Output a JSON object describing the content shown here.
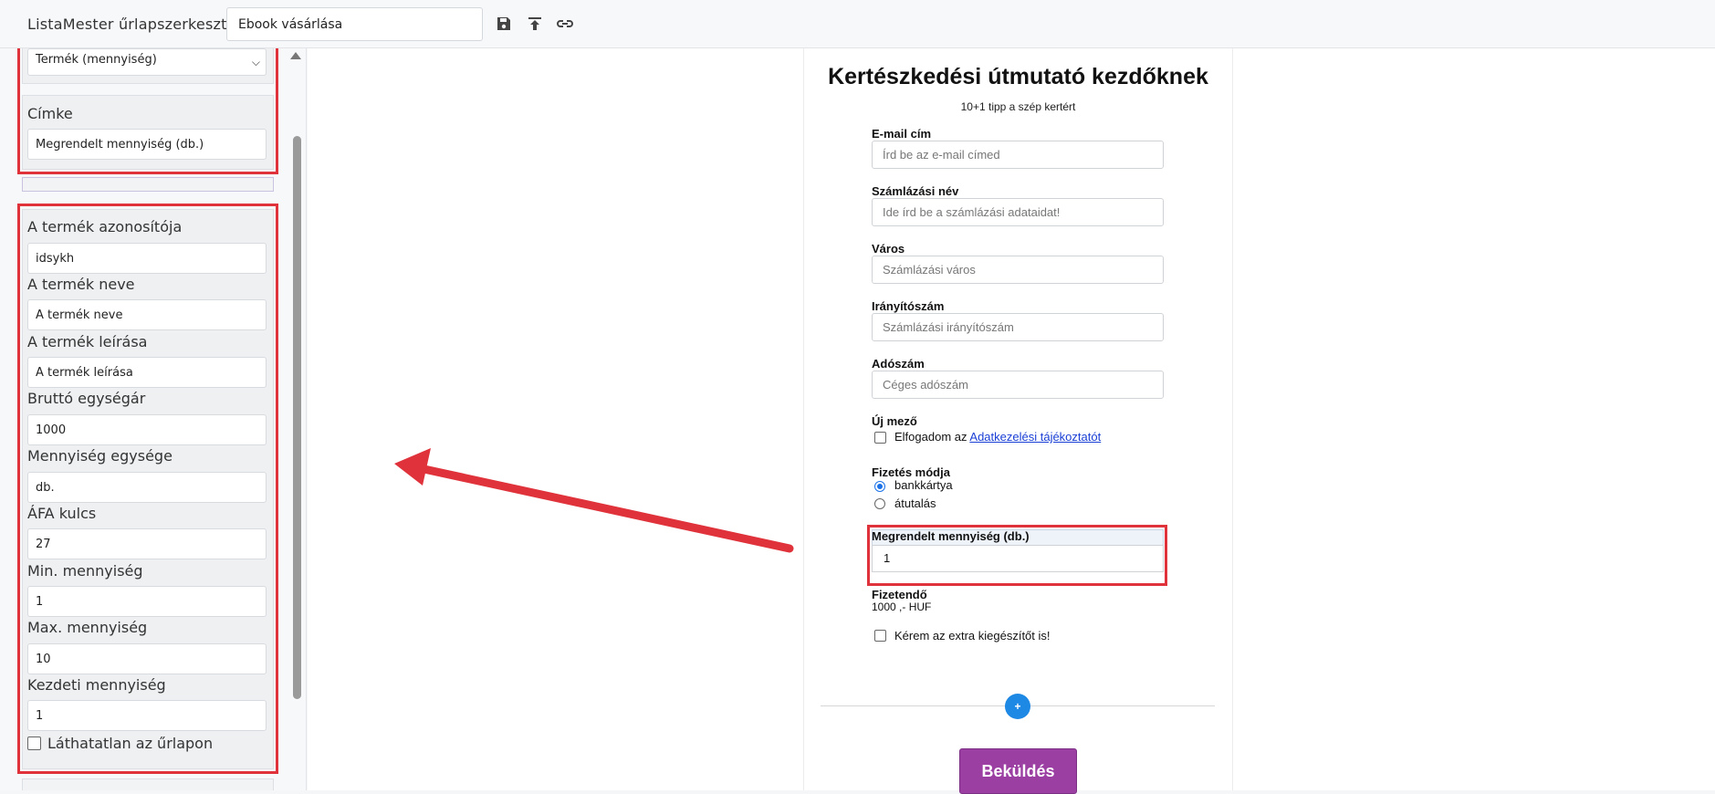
{
  "header": {
    "app_title": "ListaMester űrlapszerkesztő:",
    "form_name": "Ebook vásárlása",
    "icons": [
      "save-icon",
      "upload-icon",
      "link-icon"
    ]
  },
  "sidebar": {
    "field_type": "Termék (mennyiség)",
    "label_title": "Címke",
    "label_value": "Megrendelt mennyiség (db.)",
    "fields": [
      {
        "label": "A termék azonosítója",
        "value": "idsykh"
      },
      {
        "label": "A termék neve",
        "value": "A termék neve"
      },
      {
        "label": "A termék leírása",
        "value": "A termék leírása"
      },
      {
        "label": "Bruttó egységár",
        "value": "1000"
      },
      {
        "label": "Mennyiség egysége",
        "value": "db."
      },
      {
        "label": "ÁFA kulcs",
        "value": "27"
      },
      {
        "label": "Min. mennyiség",
        "value": "1"
      },
      {
        "label": "Max. mennyiség",
        "value": "10"
      },
      {
        "label": "Kezdeti mennyiség",
        "value": "1"
      }
    ],
    "hidden_checkbox_label": "Láthatatlan az űrlapon"
  },
  "form": {
    "title": "Kertészkedési útmutató kezdőknek",
    "subtitle": "10+1 tipp a szép kertért",
    "fields": [
      {
        "label": "E-mail cím",
        "placeholder": "Írd be az e-mail címed"
      },
      {
        "label": "Számlázási név",
        "placeholder": "Ide írd be a számlázási adataidat!"
      },
      {
        "label": "Város",
        "placeholder": "Számlázási város"
      },
      {
        "label": "Irányítószám",
        "placeholder": "Számlázási irányítószám"
      },
      {
        "label": "Adószám",
        "placeholder": "Céges adószám"
      }
    ],
    "new_field_label": "Új mező",
    "consent_prefix": "Elfogadom az",
    "consent_link": "Adatkezelési tájékoztatót",
    "payment_label": "Fizetés módja",
    "payment_options": [
      "bankkártya",
      "átutalás"
    ],
    "payment_selected": "bankkártya",
    "quantity_label": "Megrendelt mennyiség (db.)",
    "quantity_value": "1",
    "payable_label": "Fizetendő",
    "payable_value": "1000 ,- HUF",
    "extra_label": "Kérem az extra kiegészítőt is!",
    "add_button": "+",
    "submit_label": "Beküldés"
  }
}
